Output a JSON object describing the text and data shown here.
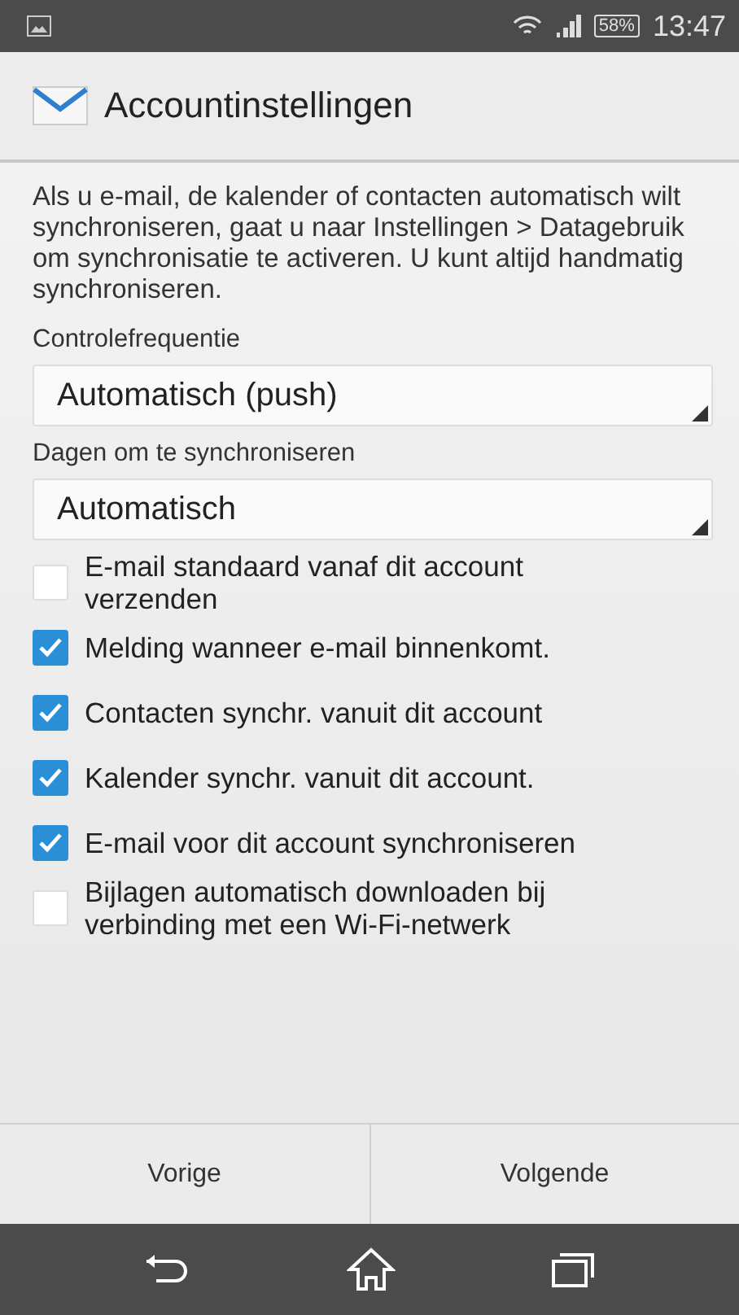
{
  "status_bar": {
    "battery": "58%",
    "time": "13:47"
  },
  "header": {
    "title": "Accountinstellingen"
  },
  "intro": "Als u e-mail, de kalender of contacten automatisch wilt synchroniseren, gaat u naar Instellingen > Datagebruik om synchronisatie te activeren. U kunt altijd handmatig synchroniseren.",
  "dropdowns": [
    {
      "label": "Controlefrequentie",
      "value": "Automatisch (push)"
    },
    {
      "label": "Dagen om te synchroniseren",
      "value": "Automatisch"
    }
  ],
  "options": [
    {
      "label": "E-mail standaard vanaf dit account verzenden",
      "checked": false
    },
    {
      "label": "Melding wanneer e-mail binnenkomt.",
      "checked": true
    },
    {
      "label": "Contacten synchr. vanuit dit account",
      "checked": true
    },
    {
      "label": "Kalender synchr. vanuit dit account.",
      "checked": true
    },
    {
      "label": "E-mail voor dit account synchroniseren",
      "checked": true
    },
    {
      "label": "Bijlagen automatisch downloaden bij verbinding met een Wi-Fi-netwerk",
      "checked": false
    }
  ],
  "buttons": [
    "Vorige",
    "Volgende"
  ]
}
